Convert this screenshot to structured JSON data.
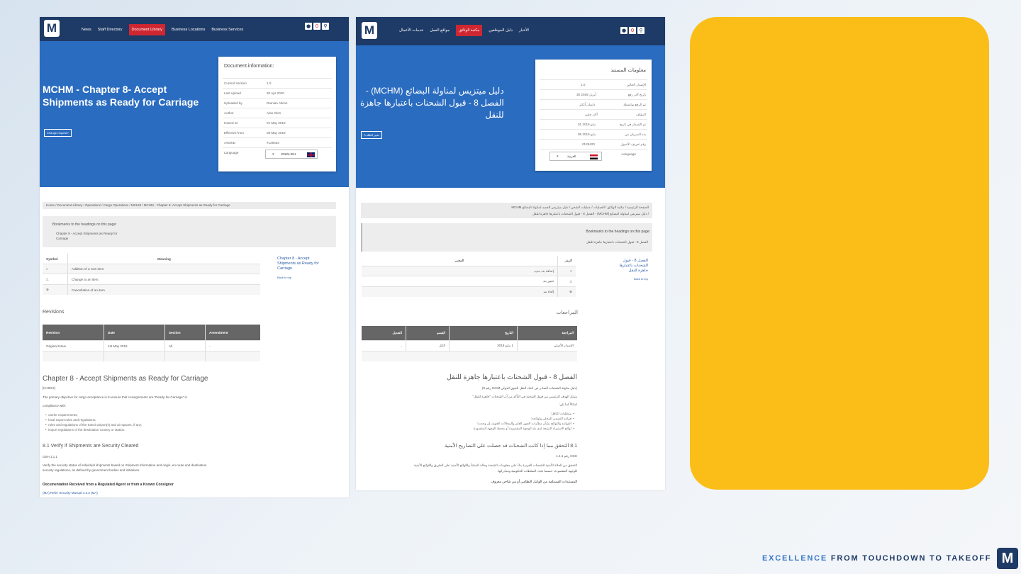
{
  "english": {
    "nav": {
      "logo": "M",
      "links": [
        "News",
        "Staff Directory",
        "Document Library",
        "Business Locations",
        "Business Services"
      ],
      "active_index": 2,
      "icons": [
        "user-icon",
        "notification-icon",
        "search-icon"
      ],
      "badge": "0"
    },
    "title": "MCHM - Chapter 8- Accept Shipments as Ready for Carriage",
    "change_button": "Change request?",
    "card": {
      "title": "Document information:",
      "rows": [
        {
          "k": "Current Version",
          "v": "1.0"
        },
        {
          "k": "Last upload",
          "v": "30 Apr 2020"
        },
        {
          "k": "Uploaded by",
          "v": "Damian Atkins"
        },
        {
          "k": "Author",
          "v": "Alan Glen"
        },
        {
          "k": "Issued on",
          "v": "01 May 2019"
        },
        {
          "k": "Effective from",
          "v": "08 May 2019"
        },
        {
          "k": "AssetID",
          "v": "#129420"
        }
      ],
      "language_label": "Language",
      "language_value": "ENGLISH",
      "caret": "▼"
    },
    "breadcrumb": "Home  /  Document Library  /  Operations  /  Cargo Operations  /  MCHM  /  MCHM - Chapter 8- Accept Shipments as Ready for Carriage",
    "bookmarks": {
      "title": "Bookmarks to the headings on this page:",
      "line1": "Chapter 8 - Accept Shipments as Ready for",
      "line2": "Carriage"
    },
    "symbols": {
      "headers": [
        "Symbol",
        "Meaning"
      ],
      "rows": [
        {
          "s": "□",
          "m": "Addition of a new item."
        },
        {
          "s": "△",
          "m": "Change to an item."
        },
        {
          "s": "⊗",
          "m": "Cancellation of an item."
        }
      ]
    },
    "side_link": {
      "line1": "Chapter 8 - Accept",
      "line2": "Shipments as Ready for",
      "line3": "Carriage",
      "back": "Back to top"
    },
    "revisions": {
      "title": "Revisions",
      "headers": [
        "Revision",
        "Date",
        "Section",
        "Amendment"
      ],
      "rows": [
        [
          "Original Issue",
          "1st May 2019",
          "All",
          "-"
        ]
      ]
    },
    "chapter": {
      "title": "Chapter 8 - Accept Shipments as Ready for Carriage",
      "ref": "[ICHM 8]",
      "body1": "The primary objective for cargo acceptance is to ensure that consignments are \"Ready-for-Carriage\" in",
      "body2": "compliance with:",
      "bullets": [
        "carrier requirements;",
        "local export rules and regulations;",
        "rules and regulations of the transit airport(s) and air spaces, if any;",
        "import regulations of the destination country or station."
      ],
      "s81": "8.1 Verify if Shipments are Security Cleared",
      "osh": "OSH 1.1.1",
      "p81a": "Verify the security status of individual shipments based on Shipment Information and origin, en-route and destination",
      "p81b": "security regulations, as defined by government bodies and initiatives.",
      "doc_heading": "Documentation Received from a Regulated Agent or from a Known Consignor",
      "ma": "(MA) Refer Security Manual 4.3.3 (MA)"
    }
  },
  "arabic": {
    "nav": {
      "logo": "M",
      "links": [
        "خدمات الأعمال",
        "مواقع العمل",
        "مكتبة الوثائق",
        "دليل الموظفين",
        "الأخبار"
      ],
      "active_index": 2,
      "icons": [
        "user-icon",
        "notification-icon",
        "search-icon"
      ],
      "badge": "0"
    },
    "title_line1": "دليل ميتزيس لمناولة البضائع (MCHM) -",
    "title_line2": "الفصل 8 - قبول الشحنات باعتبارها جاهزة",
    "title_line3": "للنقل",
    "change_button": "تغيير الطلب؟",
    "card": {
      "title": "معلومات المستند",
      "rows": [
        {
          "k": "الإصدار الحالي",
          "v": "1.0"
        },
        {
          "k": "تاريخ آخر رفع",
          "v": "30 أبريل 2019"
        },
        {
          "k": "تم الرفع بواسطة",
          "v": "داميان أتكنز"
        },
        {
          "k": "المؤلف",
          "v": "آلان جلين"
        },
        {
          "k": "تم الإصدار في تاريخ",
          "v": "01 مايو 2019"
        },
        {
          "k": "بدء السريان من",
          "v": "08 مايو 2019"
        },
        {
          "k": "رقم تعريف الأصول",
          "v": "#129420"
        }
      ],
      "language_label": "Language",
      "language_value": "العربية",
      "caret": "▼"
    },
    "breadcrumb1": "الصفحة الرئيسية  /  مكتبة الوثائق  /  العمليات  /  عمليات الشحن  /  دليل ميتزيس الجديد لمناولة البضائع MCHM",
    "breadcrumb2": "/  دليل ميتزيس لمناولة البضائع (MCHM) - الفصل 8 - قبول الشحنات باعتبارها جاهزة للنقل",
    "bookmarks": {
      "title": "Bookmarks to the headings on this page:",
      "line1": "الفصل 8 - قبول الشحنات باعتبارها جاهزة للنقل"
    },
    "symbols": {
      "headers": [
        "الرمز",
        "المعنى"
      ],
      "rows": [
        {
          "s": "□",
          "m": "إضافة بند جديد"
        },
        {
          "s": "△",
          "m": "تغيير بند"
        },
        {
          "s": "⊗",
          "m": "إلغاء بند"
        }
      ]
    },
    "side_link": {
      "line1": "الفصل 8 - قبول",
      "line2": "الشحنات باعتبارها",
      "line3": "جاهزة للنقل",
      "back": "Back to top"
    },
    "revisions": {
      "title": "المراجعات",
      "headers": [
        "المراجعة",
        "التاريخ",
        "القسم",
        "التعديل"
      ],
      "rows": [
        [
          "الإصدار الأصلي",
          "1 مايو 2019",
          "الكل",
          "-"
        ]
      ]
    },
    "chapter": {
      "title": "الفصل 8 - قبول الشحنات باعتبارها جاهزة للنقل",
      "ref": "(دليل مناولة الشحنات الصادر عن اتحاد النقل الجوي الدولي ICHM رقم 8)",
      "body1": "يتمثل الهدف الرئيسي من قبول الشحنة في التأكد من أن الشحنات \"جاهزة للنقل\"",
      "body2": "امتثالاً لما يلي:",
      "bullets": [
        "متطلبات الناقل؛",
        "قواعد التصدير المحلي ولوائحه؛",
        "القواعد واللوائح بشأن مطارات العبور العابر والمجالات الجوية، إن وجدت؛",
        "لوائح الاستيراد المتبعة لدى بلد الوجهة المقصودة أو محطة الوجهة المقصودة."
      ],
      "s81": "8.1 التحقق مما إذا كانت الشحنات قد حصلت على التصاريح الأمنية",
      "osh": "OSH رقم 1.1.1",
      "p81a": "التحقق من الحالة الأمنية للشحنات الفردية بناءً على معلومات الشحنة وحالة المنشأ واللوائح الأمنية على الطريق واللوائح الأمنية",
      "p81b": "للوجهة المقصودة، حسبما تحدد السلطات الحكومية ومبادراتها.",
      "doc_heading": "المستندات المستلمة من الوكيل النظامي أو من شاحن معروف"
    }
  },
  "footer": {
    "tagline_part1": "EXCELLENCE",
    "tagline_part2": " FROM TOUCHDOWN TO TAKEOFF",
    "logo": "M"
  },
  "colors": {
    "nav": "#1e3a66",
    "hero": "#2a6cc0",
    "active": "#cf2732",
    "panel": "#fbbe18"
  }
}
